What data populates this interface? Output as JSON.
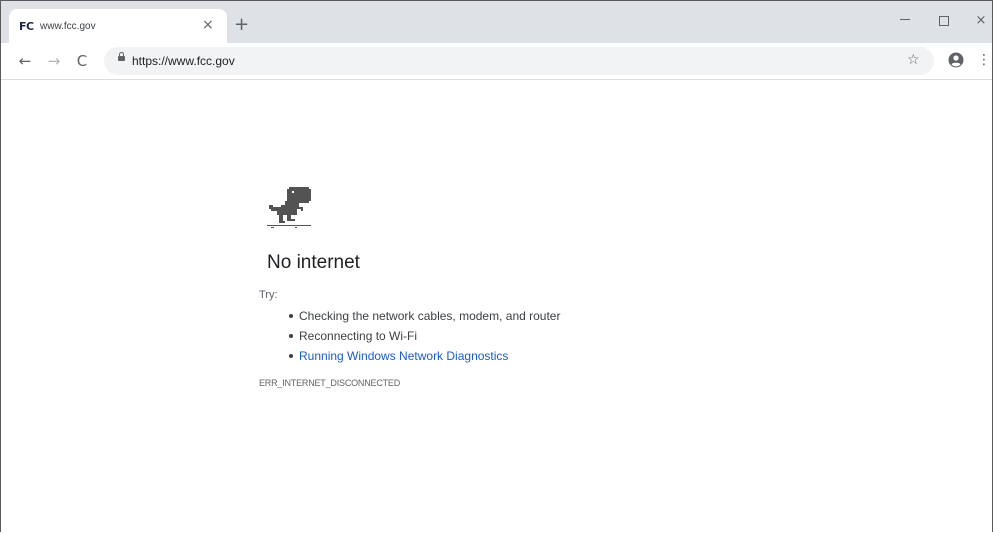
{
  "tab": {
    "favicon_text": "FC",
    "title": "www.fcc.gov",
    "close_glyph": "×",
    "new_tab_glyph": "+"
  },
  "window_controls": {
    "close_glyph": "×"
  },
  "toolbar": {
    "back_glyph": "←",
    "forward_glyph": "→",
    "reload_glyph": "C",
    "url": "https://www.fcc.gov",
    "bookmark_glyph": "☆",
    "menu_glyph": "⋮"
  },
  "error_page": {
    "title": "No internet",
    "try_label": "Try:",
    "suggestions": [
      "Checking the network cables, modem, and router",
      "Reconnecting to Wi-Fi",
      "Running Windows Network Diagnostics"
    ],
    "error_code": "ERR_INTERNET_DISCONNECTED"
  },
  "icons": {
    "favicon": "fcc-logo-icon",
    "lock": "lock-icon",
    "bookmark": "star-icon",
    "profile": "account-circle-icon",
    "menu": "more-vertical-icon",
    "offline": "dinosaur-icon"
  },
  "colors": {
    "tabstrip_bg": "#dee1e6",
    "omnibox_bg": "#f1f3f4",
    "link": "#1a5bc4",
    "text": "#202124"
  }
}
